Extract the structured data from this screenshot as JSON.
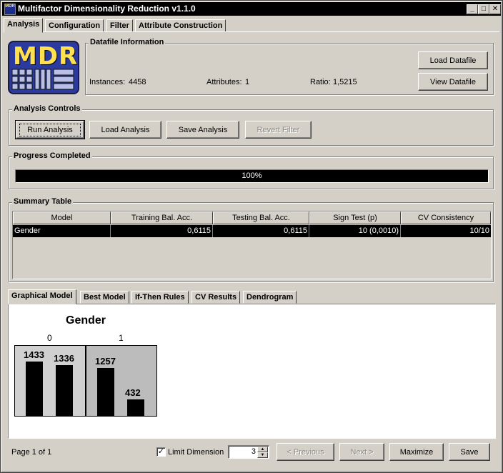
{
  "window": {
    "title": "Multifactor Dimensionality Reduction v1.1.0",
    "app_icon_text": "MDR",
    "minimize": "_",
    "maximize": "□",
    "close": "✕"
  },
  "top_tabs": [
    "Analysis",
    "Configuration",
    "Filter",
    "Attribute Construction"
  ],
  "logo": {
    "text": "MDR",
    "color": "#2b3a9f",
    "accent": "#ffe14d"
  },
  "datafile": {
    "group_title": "Datafile Information",
    "instances_label": "Instances:",
    "instances_value": "4458",
    "attributes_label": "Attributes:",
    "attributes_value": "1",
    "ratio_label": "Ratio:",
    "ratio_value": "1,5215",
    "load_button": "Load Datafile",
    "view_button": "View Datafile"
  },
  "analysis_controls": {
    "group_title": "Analysis Controls",
    "run": "Run Analysis",
    "load": "Load Analysis",
    "save": "Save Analysis",
    "revert": "Revert Filter"
  },
  "progress": {
    "group_title": "Progress Completed",
    "value_text": "100%",
    "fraction": 1.0
  },
  "summary": {
    "group_title": "Summary Table",
    "columns": [
      "Model",
      "Training Bal. Acc.",
      "Testing Bal. Acc.",
      "Sign Test (p)",
      "CV Consistency"
    ],
    "rows": [
      [
        "Gender",
        "0,6115",
        "0,6115",
        "10 (0,0010)",
        "10/10"
      ]
    ]
  },
  "bottom_tabs": [
    "Graphical Model",
    "Best Model",
    "If-Then Rules",
    "CV Results",
    "Dendrogram"
  ],
  "graphical_model": {
    "attribute": "Gender",
    "levels": [
      "0",
      "1"
    ],
    "cells": [
      {
        "level": "0",
        "shade": "#d0d0d0",
        "bars": [
          1433,
          1336
        ]
      },
      {
        "level": "1",
        "shade": "#bcbcbc",
        "bars": [
          1257,
          432
        ]
      }
    ],
    "max_count": 1433
  },
  "footer": {
    "page_text": "Page 1 of 1",
    "limit_label": "Limit Dimension",
    "limit_checked": true,
    "check_mark": "✓",
    "dimension_value": "3",
    "previous": "< Previous",
    "next": "Next >",
    "maximize": "Maximize",
    "save": "Save"
  }
}
